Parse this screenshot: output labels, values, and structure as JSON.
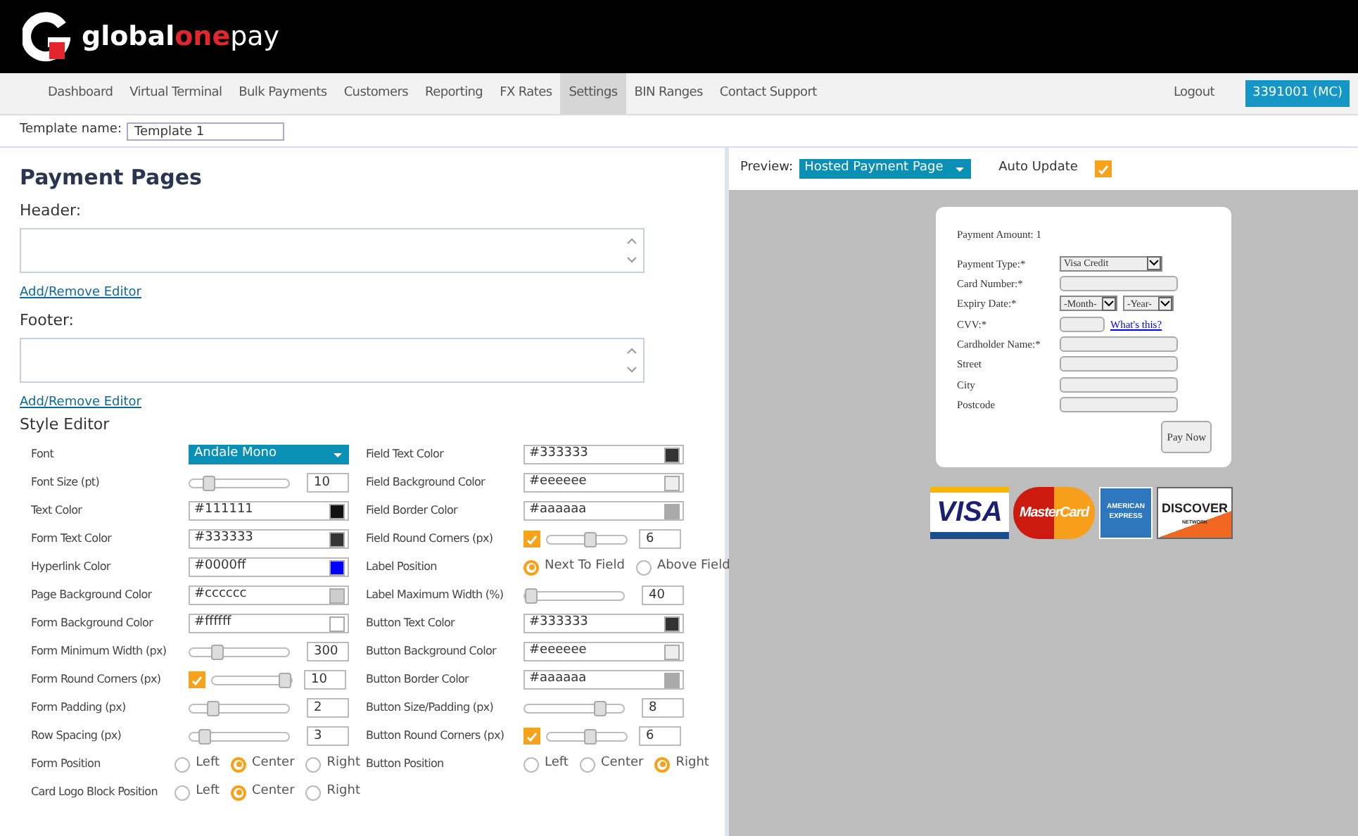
{
  "header": {
    "logo": [
      {
        "text": "global",
        "kind": "bold"
      },
      {
        "text": "one",
        "kind": "accent"
      },
      {
        "text": "pay",
        "kind": "light"
      }
    ]
  },
  "nav": {
    "items": [
      {
        "label": "Dashboard",
        "selected": false
      },
      {
        "label": "Virtual Terminal",
        "selected": false
      },
      {
        "label": "Bulk Payments",
        "selected": false
      },
      {
        "label": "Customers",
        "selected": false
      },
      {
        "label": "Reporting",
        "selected": false
      },
      {
        "label": "FX Rates",
        "selected": false
      },
      {
        "label": "Settings",
        "selected": true
      },
      {
        "label": "BIN Ranges",
        "selected": false
      },
      {
        "label": "Contact Support",
        "selected": false
      }
    ],
    "logout": "Logout",
    "account": "3391001 (MC)"
  },
  "template": {
    "label": "Template name:",
    "value": "Template 1"
  },
  "editor": {
    "title": "Payment Pages",
    "header_label": "Header:",
    "header_link": "Add/Remove Editor",
    "footer_label": "Footer:",
    "footer_link": "Add/Remove Editor",
    "style_title": "Style Editor",
    "columns": [
      [
        {
          "label": "Font",
          "kind": "select",
          "value": "Andale Mono"
        },
        {
          "label": "Font Size (pt)",
          "kind": "slider",
          "level": 0.15,
          "value": "10"
        },
        {
          "label": "Text Color",
          "kind": "color",
          "value": "#111111",
          "color": "#111111"
        },
        {
          "label": "Form Text Color",
          "kind": "color",
          "value": "#333333",
          "color": "#333333"
        },
        {
          "label": "Hyperlink Color",
          "kind": "color",
          "value": "#0000ff",
          "color": "#0000ff"
        },
        {
          "label": "Page Background Color",
          "kind": "color",
          "value": "#cccccc",
          "color": "#cccccc"
        },
        {
          "label": "Form Background Color",
          "kind": "color",
          "value": "#ffffff",
          "color": "#ffffff"
        },
        {
          "label": "Form Minimum Width (px)",
          "kind": "slider",
          "level": 0.25,
          "value": "300"
        },
        {
          "label": "Form Round Corners (px)",
          "kind": "check-slider",
          "checked": true,
          "level": 1,
          "value": "10"
        },
        {
          "label": "Form Padding (px)",
          "kind": "slider",
          "level": 0.2,
          "value": "2"
        },
        {
          "label": "Row Spacing (px)",
          "kind": "slider",
          "level": 0.1,
          "value": "3"
        },
        {
          "label": "Form Position",
          "kind": "radio",
          "options": [
            {
              "label": "Left",
              "selected": false
            },
            {
              "label": "Center",
              "selected": true
            },
            {
              "label": "Right",
              "selected": false
            }
          ]
        },
        {
          "label": "Card Logo Block Position",
          "kind": "radio",
          "options": [
            {
              "label": "Left",
              "selected": false
            },
            {
              "label": "Center",
              "selected": true
            },
            {
              "label": "Right",
              "selected": false
            }
          ]
        }
      ],
      [
        {
          "label": "Field Text Color",
          "kind": "color",
          "value": "#333333",
          "color": "#333333"
        },
        {
          "label": "Field Background Color",
          "kind": "color",
          "value": "#eeeeee",
          "color": "#eeeeee"
        },
        {
          "label": "Field Border Color",
          "kind": "color",
          "value": "#aaaaaa",
          "color": "#aaaaaa"
        },
        {
          "label": "Field Round Corners (px)",
          "kind": "check-slider",
          "checked": true,
          "level": 0.55,
          "value": "6"
        },
        {
          "label": "Label Position",
          "kind": "radio",
          "options": [
            {
              "label": "Next To Field",
              "selected": true
            },
            {
              "label": "Above Field",
              "selected": false
            }
          ]
        },
        {
          "label": "Label Maximum Width (%)",
          "kind": "slider",
          "level": 0,
          "value": "40"
        },
        {
          "label": "Button Text Color",
          "kind": "color",
          "value": "#333333",
          "color": "#333333"
        },
        {
          "label": "Button Background Color",
          "kind": "color",
          "value": "#eeeeee",
          "color": "#eeeeee"
        },
        {
          "label": "Button Border Color",
          "kind": "color",
          "value": "#aaaaaa",
          "color": "#aaaaaa"
        },
        {
          "label": "Button Size/Padding (px)",
          "kind": "slider",
          "level": 0.8,
          "value": "8"
        },
        {
          "label": "Button Round Corners (px)",
          "kind": "check-slider",
          "checked": true,
          "level": 0.55,
          "value": "6"
        },
        {
          "label": "Button Position",
          "kind": "radio",
          "options": [
            {
              "label": "Left",
              "selected": false
            },
            {
              "label": "Center",
              "selected": false
            },
            {
              "label": "Right",
              "selected": true
            }
          ]
        }
      ]
    ]
  },
  "preview": {
    "label": "Preview:",
    "select": "Hosted Payment Page",
    "auto_update": {
      "label": "Auto Update",
      "checked": true
    },
    "form": {
      "amount": "Payment Amount: 1",
      "fields": [
        {
          "label": "Payment Type:*",
          "kind": "select",
          "value": "Visa Credit"
        },
        {
          "label": "Card Number:*",
          "kind": "text"
        },
        {
          "label": "Expiry Date:*",
          "kind": "expiry",
          "month": "-Month-",
          "year": "-Year-"
        },
        {
          "label": "CVV:*",
          "kind": "cvv",
          "link": "What's this?"
        },
        {
          "label": "Cardholder Name:*",
          "kind": "text"
        },
        {
          "label": "Street",
          "kind": "text"
        },
        {
          "label": "City",
          "kind": "text"
        },
        {
          "label": "Postcode",
          "kind": "text"
        }
      ],
      "button": "Pay Now"
    },
    "card_logos": [
      {
        "kind": "visa",
        "lines": [
          "VISA"
        ]
      },
      {
        "kind": "mastercard",
        "lines": [
          "MasterCard"
        ]
      },
      {
        "kind": "amex",
        "lines": [
          "AMERICAN",
          "EXPRESS"
        ]
      },
      {
        "kind": "discover",
        "lines": [
          "DISCOVER",
          "NETWORK"
        ]
      }
    ]
  }
}
